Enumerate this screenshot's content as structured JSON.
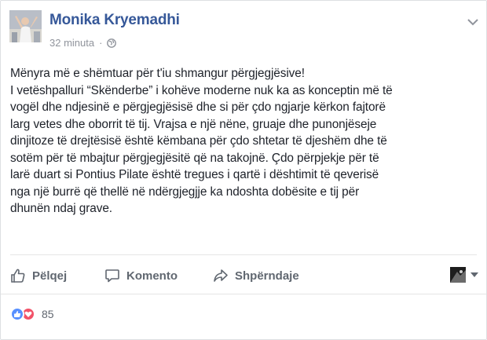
{
  "post": {
    "author": "Monika Kryemadhi",
    "time": "32 minuta",
    "separator": "·",
    "audience_icon": "globe-icon",
    "body_lines": [
      "Mënyra më e shëmtuar për t'iu shmangur përgjegjësive!",
      "I vetëshpalluri “Skënderbe” i kohëve moderne nuk ka as konceptin më të",
      "vogël dhe ndjesinë e përgjegjësisë dhe si për çdo ngjarje kërkon fajtorë",
      "larg vetes dhe oborrit të tij. Vrajsa e një nëne, gruaje dhe punonjëseje",
      "dinjitoze të drejtësisë është këmbana për çdo shtetar të djeshëm dhe të",
      "sotëm për të mbajtur përgjegjësitë që na takojnë. Çdo përpjekje për të",
      "larë duart si Pontius Pilate është tregues i qartë i dështimit të qeverisë",
      "nga një burrë që thellë në ndërgjegjje ka ndoshta dobësite e tij për",
      "dhunën ndaj grave."
    ]
  },
  "actions": {
    "like_label": "Pëlqej",
    "comment_label": "Komento",
    "share_label": "Shpërndaje"
  },
  "reactions": {
    "count": "85",
    "types": [
      "like",
      "love"
    ]
  },
  "colors": {
    "author_link": "#365899",
    "secondary_text": "#90949c",
    "action_text": "#606770",
    "like_blue": "#5890ff",
    "love_red": "#f25268"
  }
}
